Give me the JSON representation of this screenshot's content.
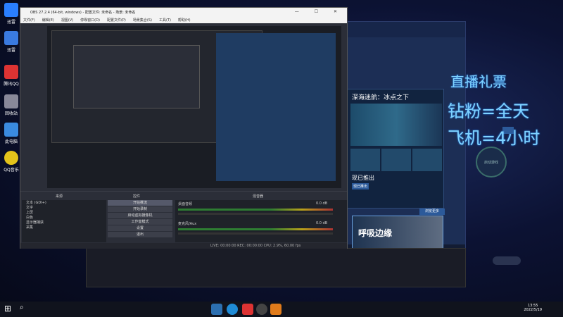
{
  "desktop": {
    "icons": [
      {
        "label": "迅雷",
        "color": "#2a7fff"
      },
      {
        "label": "腾讯QQ",
        "color": "#d33"
      },
      {
        "label": "回收站",
        "color": "#999"
      },
      {
        "label": "",
        "color": "#e3c31b"
      },
      {
        "label": "此电脑",
        "color": "#3a8ae0"
      },
      {
        "label": "QQ音乐",
        "color": "#1eb23a"
      }
    ]
  },
  "launcher": {
    "card_title": "深海迷航：冰点之下",
    "card_subtitle": "现已推出",
    "tag": "现已推出",
    "banner_text": "呼吸边缘",
    "circle_label": "启动游戏",
    "side_btn": "浏览更多"
  },
  "overlay": {
    "line1": "直播礼票",
    "line2": "钻粉=全天",
    "line3": "飞机=4小时"
  },
  "obs": {
    "title": "OBS 27.2.4 (64-bit, windows) - 配置文件: 未命名 - 场景: 未命名",
    "menu": [
      "文件(F)",
      "编辑(E)",
      "视图(V)",
      "停靠窗口(D)",
      "配置文件(P)",
      "场景集合(S)",
      "工具(T)",
      "帮助(H)"
    ],
    "scenes_header": "来源",
    "transitions_header": "控件",
    "mixer_header": "混音器",
    "sources": [
      "文本 (GDI+)",
      "文字",
      "上屏",
      "白色",
      "显示器捕获",
      "采集"
    ],
    "controls": [
      "开始推流",
      "开始录制",
      "启动虚拟摄像机",
      "工作室模式",
      "设置",
      "退出"
    ],
    "mixer_tracks": [
      "桌面音频",
      "麦克风/Aux"
    ],
    "mixer_db": [
      "0.0 dB",
      "0.0 dB"
    ],
    "status": "LIVE: 00:00:00   REC: 00:00:00   CPU: 2.9%, 60.00 fps"
  },
  "taskbar": {
    "time": "13:55",
    "date": "2022/5/19"
  }
}
